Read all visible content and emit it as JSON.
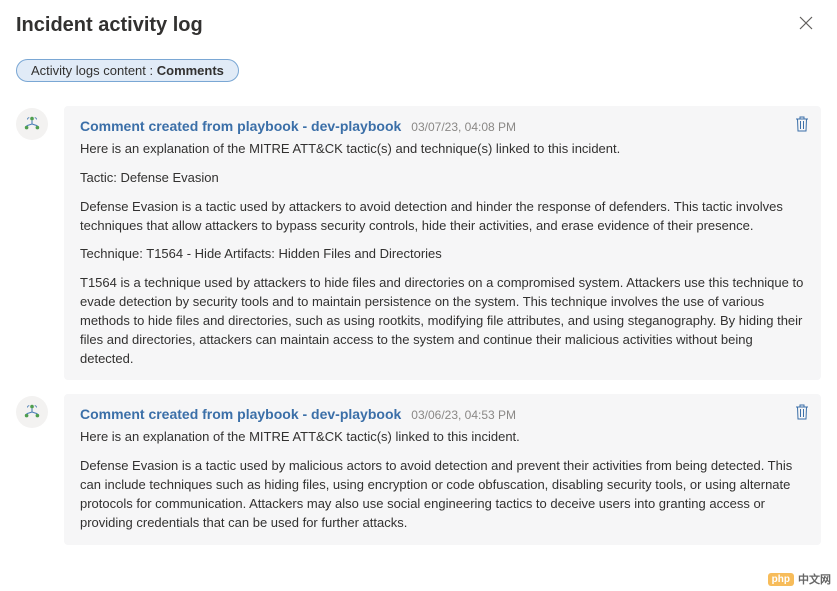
{
  "header": {
    "title": "Incident activity log"
  },
  "filter": {
    "label": "Activity logs content : ",
    "value": "Comments"
  },
  "entries": [
    {
      "title": "Comment created from playbook - dev-playbook",
      "timestamp": "03/07/23, 04:08 PM",
      "paragraphs": [
        "Here is an explanation of the MITRE ATT&CK tactic(s) and technique(s) linked to this incident.",
        "Tactic: Defense Evasion",
        "Defense Evasion is a tactic used by attackers to avoid detection and hinder the response of defenders. This tactic involves techniques that allow attackers to bypass security controls, hide their activities, and erase evidence of their presence.",
        "Technique: T1564 - Hide Artifacts: Hidden Files and Directories",
        "T1564 is a technique used by attackers to hide files and directories on a compromised system. Attackers use this technique to evade detection by security tools and to maintain persistence on the system. This technique involves the use of various methods to hide files and directories, such as using rootkits, modifying file attributes, and using steganography. By hiding their files and directories, attackers can maintain access to the system and continue their malicious activities without being detected."
      ]
    },
    {
      "title": "Comment created from playbook - dev-playbook",
      "timestamp": "03/06/23, 04:53 PM",
      "paragraphs": [
        "Here is an explanation of the MITRE ATT&CK tactic(s) linked to this incident.",
        "Defense Evasion is a tactic used by malicious actors to avoid detection and prevent their activities from being detected. This can include techniques such as hiding files, using encryption or code obfuscation, disabling security tools, or using alternate protocols for communication. Attackers may also use social engineering tactics to deceive users into granting access or providing credentials that can be used for further attacks."
      ]
    }
  ],
  "watermark": {
    "badge": "php",
    "text": "中文网"
  }
}
